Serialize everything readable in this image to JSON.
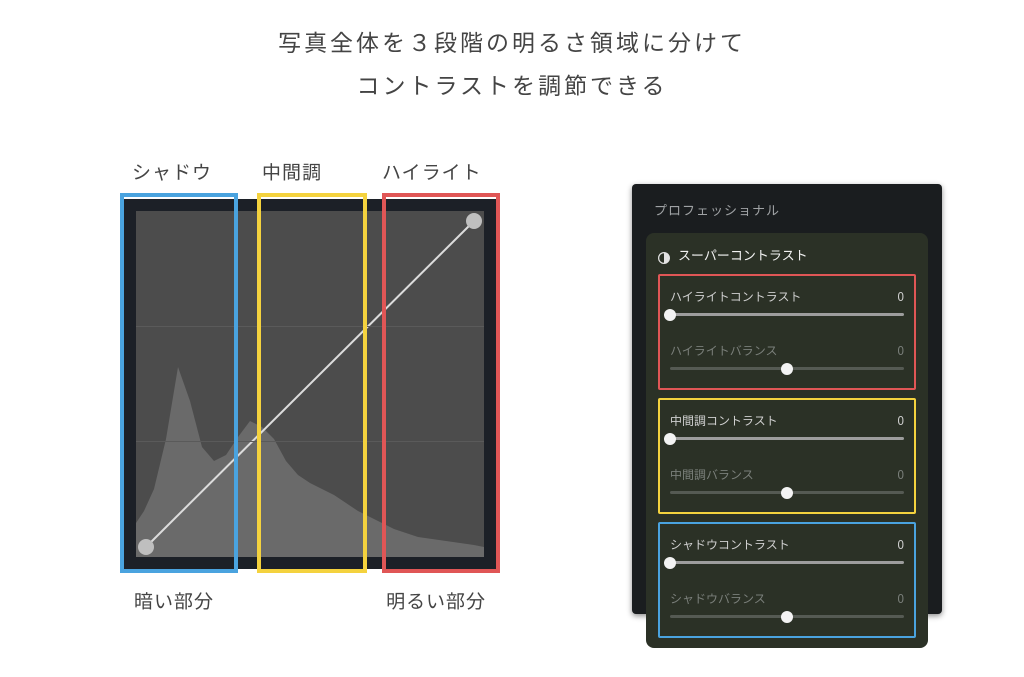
{
  "headline": {
    "line1": "写真全体を３段階の明るさ領域に分けて",
    "line2": "コントラストを調節できる"
  },
  "regions": {
    "shadow_label": "シャドウ",
    "midtone_label": "中間調",
    "highlight_label": "ハイライト",
    "dark_caption": "暗い部分",
    "bright_caption": "明るい部分",
    "colors": {
      "shadow": "#4aa3df",
      "midtone": "#f4d23e",
      "highlight": "#e05656"
    }
  },
  "panel": {
    "header": "プロフェッショナル",
    "section_title": "スーパーコントラスト",
    "sliders": {
      "highlight_contrast": {
        "label": "ハイライトコントラスト",
        "value": "0",
        "pos": 0
      },
      "highlight_balance": {
        "label": "ハイライトバランス",
        "value": "0",
        "pos": 50
      },
      "midtone_contrast": {
        "label": "中間調コントラスト",
        "value": "0",
        "pos": 0
      },
      "midtone_balance": {
        "label": "中間調バランス",
        "value": "0",
        "pos": 50
      },
      "shadow_contrast": {
        "label": "シャドウコントラスト",
        "value": "0",
        "pos": 0
      },
      "shadow_balance": {
        "label": "シャドウバランス",
        "value": "0",
        "pos": 50
      }
    }
  },
  "chart_data": {
    "type": "line",
    "title": "Tone curve with histogram",
    "curve": {
      "x": [
        0,
        255
      ],
      "y": [
        0,
        255
      ]
    },
    "endpoints": [
      {
        "x": 0,
        "y": 0
      },
      {
        "x": 255,
        "y": 255
      }
    ],
    "xlim": [
      0,
      255
    ],
    "ylim": [
      0,
      255
    ],
    "grid_rows": 3,
    "histogram": {
      "bins_x": [
        0,
        8,
        16,
        24,
        32,
        40,
        48,
        56,
        64,
        72,
        80,
        88,
        96,
        104,
        112,
        120,
        128,
        136,
        144,
        152,
        160,
        168,
        176,
        184,
        192,
        200,
        208,
        216,
        224,
        232,
        240,
        248,
        255
      ],
      "bins_h": [
        0.1,
        0.15,
        0.22,
        0.34,
        0.55,
        0.45,
        0.32,
        0.28,
        0.3,
        0.35,
        0.4,
        0.38,
        0.34,
        0.28,
        0.24,
        0.21,
        0.2,
        0.18,
        0.16,
        0.14,
        0.12,
        0.1,
        0.08,
        0.07,
        0.06,
        0.05,
        0.048,
        0.046,
        0.044,
        0.04,
        0.036,
        0.03,
        0.028
      ],
      "y_scale_note": "fraction of panel height"
    },
    "region_split_x": [
      0,
      85,
      170,
      255
    ]
  }
}
